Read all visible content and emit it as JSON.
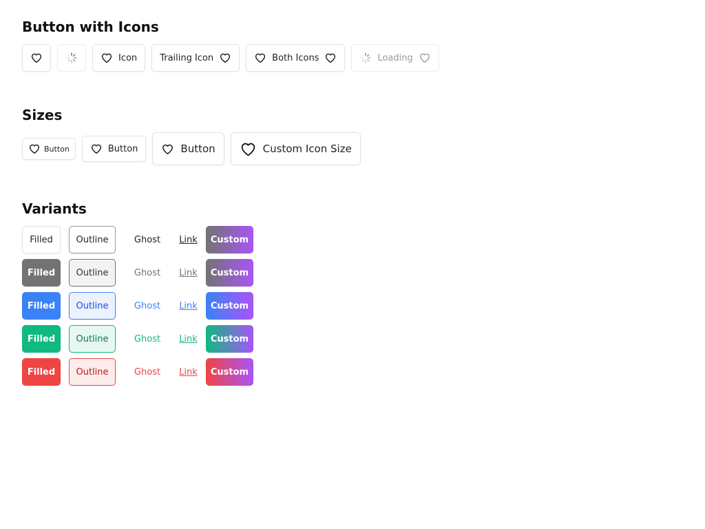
{
  "sections": {
    "icons_title": "Button with Icons",
    "sizes_title": "Sizes",
    "variants_title": "Variants"
  },
  "icons_row": {
    "icon_label": "Icon",
    "trailing_label": "Trailing Icon",
    "both_label": "Both Icons",
    "loading_label": "Loading"
  },
  "sizes_row": {
    "xs_label": "Button",
    "sm_label": "Button",
    "md_label": "Button",
    "custom_label": "Custom Icon Size"
  },
  "variants": {
    "labels": {
      "filled": "Filled",
      "outline": "Outline",
      "ghost": "Ghost",
      "link": "Link",
      "custom": "Custom"
    },
    "colors": {
      "gray": "#737373",
      "blue": "#3b82f6",
      "green": "#10b981",
      "red": "#ef4444",
      "purple": "#a855f7"
    }
  }
}
